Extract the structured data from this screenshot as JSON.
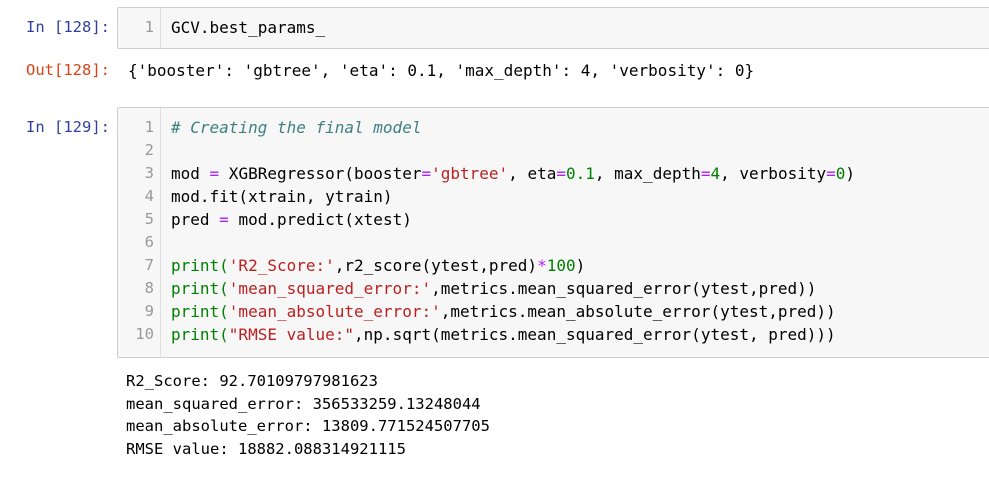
{
  "cell128": {
    "in_prompt": "In [128]:",
    "out_prompt": "Out[128]:",
    "lines": [
      {
        "n": "1",
        "segs": [
          {
            "t": "GCV.best_params_",
            "c": ""
          }
        ]
      }
    ],
    "output": "{'booster': 'gbtree', 'eta': 0.1, 'max_depth': 4, 'verbosity': 0}"
  },
  "cell129": {
    "in_prompt": "In [129]:",
    "lines": [
      {
        "n": "1",
        "segs": [
          {
            "t": "# Creating the final model",
            "c": "tok-comment"
          }
        ]
      },
      {
        "n": "2",
        "segs": []
      },
      {
        "n": "3",
        "segs": [
          {
            "t": "mod ",
            "c": ""
          },
          {
            "t": "=",
            "c": "tok-op"
          },
          {
            "t": " XGBRegressor(booster",
            "c": ""
          },
          {
            "t": "=",
            "c": "tok-op"
          },
          {
            "t": "'gbtree'",
            "c": "tok-str"
          },
          {
            "t": ", eta",
            "c": ""
          },
          {
            "t": "=",
            "c": "tok-op"
          },
          {
            "t": "0.1",
            "c": "tok-num"
          },
          {
            "t": ", max_depth",
            "c": ""
          },
          {
            "t": "=",
            "c": "tok-op"
          },
          {
            "t": "4",
            "c": "tok-num"
          },
          {
            "t": ", verbosity",
            "c": ""
          },
          {
            "t": "=",
            "c": "tok-op"
          },
          {
            "t": "0",
            "c": "tok-num"
          },
          {
            "t": ")",
            "c": ""
          }
        ]
      },
      {
        "n": "4",
        "segs": [
          {
            "t": "mod.fit(xtrain, ytrain)",
            "c": ""
          }
        ]
      },
      {
        "n": "5",
        "segs": [
          {
            "t": "pred ",
            "c": ""
          },
          {
            "t": "=",
            "c": "tok-op"
          },
          {
            "t": " mod.predict(xtest)",
            "c": ""
          }
        ]
      },
      {
        "n": "6",
        "segs": []
      },
      {
        "n": "7",
        "segs": [
          {
            "t": "print(",
            "c": "tok-num"
          },
          {
            "t": "'R2_Score:'",
            "c": "tok-str"
          },
          {
            "t": ",r2_score(ytest,pred)",
            "c": ""
          },
          {
            "t": "*",
            "c": "tok-op"
          },
          {
            "t": "100",
            "c": "tok-num"
          },
          {
            "t": ")",
            "c": ""
          }
        ]
      },
      {
        "n": "8",
        "segs": [
          {
            "t": "print(",
            "c": "tok-num"
          },
          {
            "t": "'mean_squared_error:'",
            "c": "tok-str"
          },
          {
            "t": ",metrics.mean_squared_error(ytest,pred))",
            "c": ""
          }
        ]
      },
      {
        "n": "9",
        "segs": [
          {
            "t": "print(",
            "c": "tok-num"
          },
          {
            "t": "'mean_absolute_error:'",
            "c": "tok-str"
          },
          {
            "t": ",metrics.mean_absolute_error(ytest,pred))",
            "c": ""
          }
        ]
      },
      {
        "n": "10",
        "segs": [
          {
            "t": "print(",
            "c": "tok-num"
          },
          {
            "t": "\"RMSE value:\"",
            "c": "tok-str"
          },
          {
            "t": ",np.sqrt(metrics.mean_squared_error(ytest, pred)))",
            "c": ""
          }
        ]
      }
    ],
    "output_lines": [
      "R2_Score: 92.70109797981623",
      "mean_squared_error: 356533259.13248044",
      "mean_absolute_error: 13809.771524507705",
      "RMSE value: 18882.088314921115"
    ]
  },
  "colors": {
    "in_prompt": "#303f9f",
    "out_prompt": "#d84315",
    "string": "#ba2121",
    "number": "#008000",
    "operator": "#aa22ff",
    "comment": "#408080",
    "input_bg": "#f7f7f7"
  }
}
